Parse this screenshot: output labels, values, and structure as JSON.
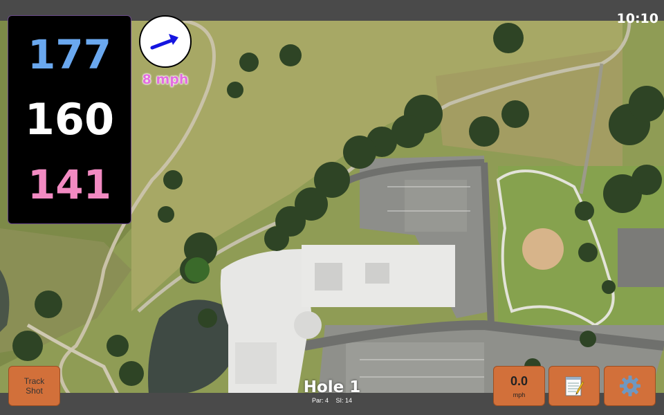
{
  "status": {
    "time": "10:10"
  },
  "distances": {
    "back": "177",
    "middle": "160",
    "front": "141"
  },
  "wind": {
    "speed_label": "8 mph",
    "icon": "wind-direction-arrow-icon"
  },
  "hole": {
    "title": "Hole 1",
    "par": "Par: 4",
    "stroke_index": "SI: 14"
  },
  "buttons": {
    "track_shot_line1": "Track",
    "track_shot_line2": "Shot",
    "speed_value": "0.0",
    "speed_unit": "mph",
    "notes_icon": "notepad-icon",
    "settings_icon": "gear-icon"
  },
  "colors": {
    "back_distance": "#6aa8ef",
    "middle_distance": "#ffffff",
    "front_distance": "#f28ac2",
    "wind_text": "#e36ee0",
    "button": "#d2703a"
  }
}
